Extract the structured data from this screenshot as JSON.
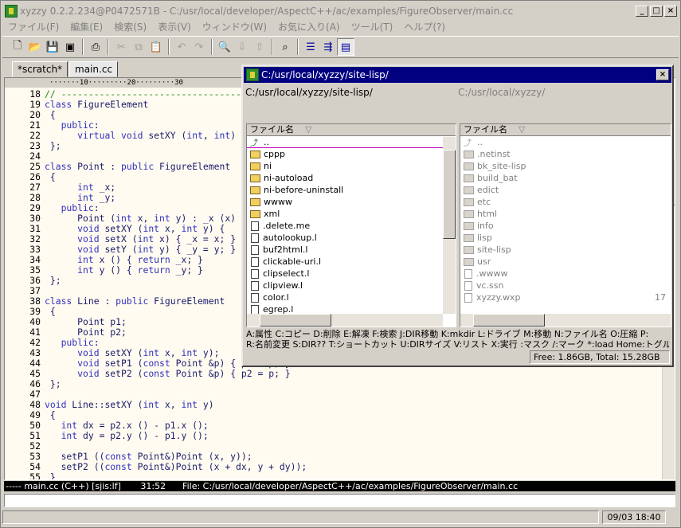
{
  "window": {
    "title": "xyzzy 0.2.2.234@P0472571B - C:/usr/local/developer/AspectC++/ac/examples/FigureObserver/main.cc",
    "buttons": {
      "minimize": "_",
      "maximize": "□",
      "close": "×"
    }
  },
  "menu": [
    "ファイル(F)",
    "編集(E)",
    "検索(S)",
    "表示(V)",
    "ウィンドウ(W)",
    "お気に入り(A)",
    "ツール(T)",
    "ヘルプ(?)"
  ],
  "toolbar": {
    "icons": [
      "new-file-icon",
      "open-file-icon",
      "save-icon",
      "save-all-icon",
      "print-icon",
      "cut-icon",
      "copy-icon",
      "paste-icon",
      "undo-icon",
      "redo-icon",
      "search-icon",
      "search-next-icon",
      "search-prev-icon",
      "grep-icon",
      "list-icon",
      "indent-icon",
      "filer-icon"
    ]
  },
  "tabs": [
    {
      "label": "*scratch*",
      "active": false
    },
    {
      "label": "main.cc",
      "active": true
    }
  ],
  "editor": {
    "ruler": "·······10·········20·········30",
    "lines": [
      {
        "n": "18",
        "text": "// -----------------------------------"
      },
      {
        "n": "19",
        "text": "class FigureElement"
      },
      {
        "n": "20",
        "text": " {"
      },
      {
        "n": "21",
        "text": "   public:"
      },
      {
        "n": "22",
        "text": "      virtual void setXY (int, int)"
      },
      {
        "n": "23",
        "text": " };"
      },
      {
        "n": "24",
        "text": ""
      },
      {
        "n": "25",
        "text": "class Point : public FigureElement"
      },
      {
        "n": "26",
        "text": " {"
      },
      {
        "n": "27",
        "text": "      int _x;"
      },
      {
        "n": "28",
        "text": "      int _y;"
      },
      {
        "n": "29",
        "text": "   public:"
      },
      {
        "n": "30",
        "text": "      Point (int x, int y) : _x (x)"
      },
      {
        "n": "31",
        "text": "      void setXY (int x, int y) {"
      },
      {
        "n": "32",
        "text": "      void setX (int x) { _x = x; }"
      },
      {
        "n": "33",
        "text": "      void setY (int y) { _y = y; }"
      },
      {
        "n": "34",
        "text": "      int x () { return _x; }"
      },
      {
        "n": "35",
        "text": "      int y () { return _y; }"
      },
      {
        "n": "36",
        "text": " };"
      },
      {
        "n": "37",
        "text": ""
      },
      {
        "n": "38",
        "text": "class Line : public FigureElement"
      },
      {
        "n": "39",
        "text": " {"
      },
      {
        "n": "40",
        "text": "      Point p1;"
      },
      {
        "n": "41",
        "text": "      Point p2;"
      },
      {
        "n": "42",
        "text": "   public:"
      },
      {
        "n": "43",
        "text": "      void setXY (int x, int y);"
      },
      {
        "n": "44",
        "text": "      void setP1 (const Point &p) { p1 = p; }"
      },
      {
        "n": "45",
        "text": "      void setP2 (const Point &p) { p2 = p; }"
      },
      {
        "n": "46",
        "text": " };"
      },
      {
        "n": "47",
        "text": ""
      },
      {
        "n": "48",
        "text": "void Line::setXY (int x, int y)"
      },
      {
        "n": "49",
        "text": " {"
      },
      {
        "n": "50",
        "text": "   int dx = p2.x () - p1.x ();"
      },
      {
        "n": "51",
        "text": "   int dy = p2.y () - p1.y ();"
      },
      {
        "n": "52",
        "text": ""
      },
      {
        "n": "53",
        "text": "   setP1 ((const Point&)Point (x, y));"
      },
      {
        "n": "54",
        "text": "   setP2 ((const Point&)Point (x + dx, y + dy));"
      },
      {
        "n": "55",
        "text": " }"
      }
    ]
  },
  "modeline": "----- main.cc (C++) [sjis:lf]       31:52      File: C:/usr/local/developer/AspectC++/ac/examples/FigureObserver/main.cc",
  "statusbar": {
    "time": "09/03 18:40"
  },
  "filer": {
    "title": "C:/usr/local/xyzzy/site-lisp/",
    "path_left": "C:/usr/local/xyzzy/site-lisp/",
    "path_right": "C:/usr/local/xyzzy/",
    "column_header": "ファイル名",
    "sort_marker": "▽",
    "up_label": "..",
    "left_items": [
      {
        "name": "cppp",
        "kind": "folder"
      },
      {
        "name": "ni",
        "kind": "folder"
      },
      {
        "name": "ni-autoload",
        "kind": "folder"
      },
      {
        "name": "ni-before-uninstall",
        "kind": "folder"
      },
      {
        "name": "wwww",
        "kind": "folder"
      },
      {
        "name": "xml",
        "kind": "folder"
      },
      {
        "name": ".delete.me",
        "kind": "file"
      },
      {
        "name": "autolookup.l",
        "kind": "file"
      },
      {
        "name": "buf2html.l",
        "kind": "file"
      },
      {
        "name": "clickable-uri.l",
        "kind": "file"
      },
      {
        "name": "clipselect.l",
        "kind": "file"
      },
      {
        "name": "clipview.l",
        "kind": "file"
      },
      {
        "name": "color.l",
        "kind": "file"
      },
      {
        "name": "egrep.l",
        "kind": "file"
      }
    ],
    "right_items": [
      {
        "name": ".netinst",
        "kind": "folder"
      },
      {
        "name": "bk_site-lisp",
        "kind": "folder"
      },
      {
        "name": "build_bat",
        "kind": "folder"
      },
      {
        "name": "edict",
        "kind": "folder"
      },
      {
        "name": "etc",
        "kind": "folder"
      },
      {
        "name": "html",
        "kind": "folder"
      },
      {
        "name": "info",
        "kind": "folder"
      },
      {
        "name": "lisp",
        "kind": "folder"
      },
      {
        "name": "site-lisp",
        "kind": "folder"
      },
      {
        "name": "usr",
        "kind": "folder"
      },
      {
        "name": ".wwww",
        "kind": "file"
      },
      {
        "name": "vc.ssn",
        "kind": "file"
      },
      {
        "name": "xyzzy.wxp",
        "kind": "file",
        "size": "17"
      }
    ],
    "help_line_1": "A:属性  C:コピー  D:削除  E:解凍  F:検索  J:DIR移動  K:mkdir  L:ドライブ  M:移動  N:ファイル名  O:圧縮  P:",
    "help_line_2": "R:名前変更  S:DIR??  T:ショートカット  U:DIRサイズ  V:リスト  X:実行  :マスク  /:マーク  *:load  Home:トグル  S",
    "free_space": "Free: 1.86GB, Total: 15.28GB"
  }
}
